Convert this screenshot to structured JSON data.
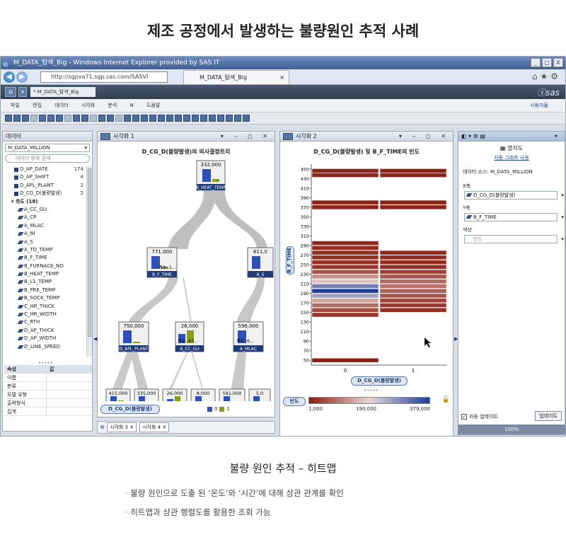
{
  "page_title": "제조 공정에서 발생하는 불량원인 추적 사례",
  "browser": {
    "window_title": "M_DATA_탐색_Big - Windows Internet Explorer provided by SAS IT",
    "address": "http://sgpva71.sgp.sas.com/SASVI",
    "tab_label": "M_DATA_탐색_Big",
    "window_buttons": [
      "_",
      "□",
      "X"
    ]
  },
  "app": {
    "doc_tab": "* M_DATA_탐색_Big",
    "logo": "ⓢsas",
    "menu": [
      "파일",
      "편집",
      "데이터",
      "시각화",
      "분석",
      "N",
      "도움말"
    ],
    "menu_right": "사용자들"
  },
  "left_panel": {
    "title": "데이터",
    "dataset": "M_DATA_MILLION",
    "search_placeholder": "데이터 항목 검색",
    "categories": [
      {
        "name": "D_AP_DATE",
        "count": "174"
      },
      {
        "name": "D_AP_SHIFT",
        "count": "4"
      },
      {
        "name": "D_APL_PLANT",
        "count": "2"
      },
      {
        "name": "D_CG_D(불량발생)",
        "count": "2"
      }
    ],
    "measures_header": "측도 (18)",
    "measures": [
      "A_CC_GU",
      "A_CP",
      "A_MLAC",
      "A_NI",
      "A_S",
      "A_TD_TEMP",
      "B_F_TIME",
      "B_FURNACE_NO",
      "B_HEAT_TEMP",
      "B_L1_TEMP",
      "B_PRE_TEMP",
      "B_SOCK_TEMP",
      "C_HR_THICK",
      "C_HR_WIDTH",
      "C_RTH",
      "D_AP_THICK",
      "D_AP_WIDTH",
      "D_LINE_SPEED"
    ],
    "properties": {
      "header": [
        "속성",
        "값"
      ],
      "rows": [
        "이름",
        "분류",
        "모델 유형",
        "출력형식",
        "집계"
      ]
    }
  },
  "tree_panel": {
    "tab": "시각화 1",
    "title": "D_CG_D(불량발생)의 의사결정트리",
    "root_value": "332,000",
    "root_label": "B_HEAT_TEMP",
    "level1": [
      {
        "value": "771,000",
        "label": "B_F_TIME",
        "subtitle": "계수: 1..."
      },
      {
        "value": "611,0",
        "label": "A_S"
      }
    ],
    "level2": [
      {
        "value": "750,000",
        "label": "D_APL_PLANT"
      },
      {
        "value": "26,000",
        "label": "A_CC_GU",
        "subtitle": "계수: 47..."
      },
      {
        "value": "596,000",
        "label": "A_MLAC",
        "subtitle": "계수: 6..."
      }
    ],
    "leaves": [
      "415,000",
      "335,000",
      "26,000",
      "8,000",
      "591,000",
      "5,0"
    ],
    "target_chip": "D_CG_D(불량발생)",
    "legend": [
      "0",
      "1"
    ]
  },
  "tabs_bottom": [
    "시각화 3",
    "시각화 4"
  ],
  "heatmap_panel": {
    "tab": "시각화 2",
    "title": "D_CG_D(불량발생) 및 B_F_TIME의 빈도",
    "y_chip": "B_F_TIME",
    "x_chip": "D_CG_D(불량발생)",
    "color_chip": "빈도",
    "color_min": "1,000",
    "color_mid": "190,000",
    "color_max": "379,000",
    "colors": {
      "low": "#8b1a0e",
      "mid": "#e6d8d4",
      "high": "#1f3d9a"
    }
  },
  "chart_data": {
    "type": "heatmap",
    "title": "D_CG_D(불량발생) 및 B_F_TIME의 빈도",
    "x_categories": [
      "0",
      "1"
    ],
    "y_ticks": [
      450,
      430,
      410,
      390,
      370,
      350,
      330,
      310,
      290,
      270,
      250,
      230,
      210,
      190,
      170,
      150,
      130,
      110,
      90,
      70,
      50
    ],
    "color_range": [
      1000,
      379000
    ],
    "rows": [
      {
        "y": 446,
        "values": [
          12000,
          9000
        ]
      },
      {
        "y": 437,
        "values": [
          14000,
          11000
        ]
      },
      {
        "y": 380,
        "values": [
          9000,
          8000
        ]
      },
      {
        "y": 370,
        "values": [
          10000,
          9000
        ]
      },
      {
        "y": 295,
        "values": [
          15000,
          null
        ]
      },
      {
        "y": 285,
        "values": [
          18000,
          null
        ]
      },
      {
        "y": 275,
        "values": [
          20000,
          16000
        ]
      },
      {
        "y": 265,
        "values": [
          22000,
          18000
        ]
      },
      {
        "y": 255,
        "values": [
          25000,
          20000
        ]
      },
      {
        "y": 245,
        "values": [
          30000,
          22000
        ]
      },
      {
        "y": 235,
        "values": [
          60000,
          40000
        ]
      },
      {
        "y": 225,
        "values": [
          120000,
          60000
        ]
      },
      {
        "y": 215,
        "values": [
          170000,
          80000
        ]
      },
      {
        "y": 205,
        "values": [
          300000,
          90000
        ]
      },
      {
        "y": 195,
        "values": [
          379000,
          70000
        ]
      },
      {
        "y": 185,
        "values": [
          260000,
          60000
        ]
      },
      {
        "y": 175,
        "values": [
          140000,
          45000
        ]
      },
      {
        "y": 165,
        "values": [
          80000,
          30000
        ]
      },
      {
        "y": 155,
        "values": [
          50000,
          20000
        ]
      },
      {
        "y": 145,
        "values": [
          30000,
          null
        ]
      },
      {
        "y": 50,
        "values": [
          8000,
          null
        ]
      }
    ],
    "xlabel": "D_CG_D(불량발생)",
    "ylabel": "B_F_TIME",
    "ylim": [
      40,
      460
    ]
  },
  "right_panel": {
    "title": "열지도",
    "link": "자동 그래프 사용",
    "source_label": "데이터 소스: M_DATA_MILLION",
    "x_label": "X축",
    "x_value": "D_CG_D(불량발생)",
    "y_label": "Y축",
    "y_value": "B_F_TIME",
    "color_label": "색상",
    "color_value": "빈도",
    "auto_update": "자동 업데이트",
    "update_button": "업데이트",
    "zoom": "100%"
  },
  "caption": "불량 원인 추적 – 히트맵",
  "bullets": [
    "불량 원인으로 도출 된 ‘온도’와 ‘시간’에 대해 상관 관계를 확인",
    "히트맵과 상관 행렬도를 활용한 조회 가능"
  ]
}
